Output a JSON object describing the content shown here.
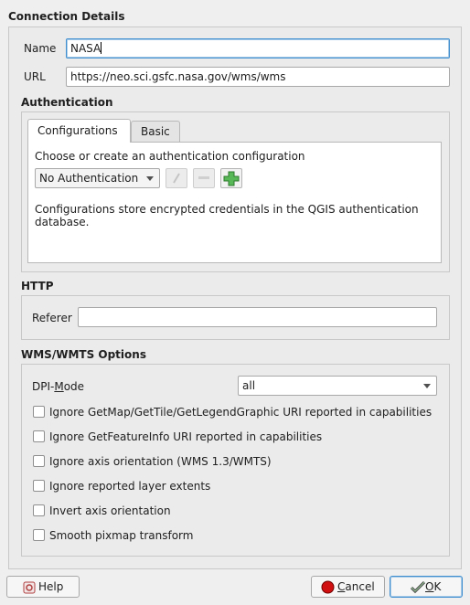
{
  "connection": {
    "title": "Connection Details",
    "name_label": "Name",
    "name_value": "NASA",
    "url_label": "URL",
    "url_value": "https://neo.sci.gsfc.nasa.gov/wms/wms"
  },
  "auth": {
    "title": "Authentication",
    "tabs": [
      "Configurations",
      "Basic"
    ],
    "choose_text": "Choose or create an authentication configuration",
    "selected": "No Authentication",
    "info_text": "Configurations store encrypted credentials in the QGIS authentication database."
  },
  "http": {
    "title": "HTTP",
    "referer_label": "Referer",
    "referer_value": ""
  },
  "wms": {
    "title": "WMS/WMTS Options",
    "dpi_label_pre": "DPI-",
    "dpi_label_u": "M",
    "dpi_label_post": "ode",
    "dpi_value": "all",
    "options": [
      "Ignore GetMap/GetTile/GetLegendGraphic URI reported in capabilities",
      "Ignore GetFeatureInfo URI reported in capabilities",
      "Ignore axis orientation (WMS 1.3/WMTS)",
      "Ignore reported layer extents",
      "Invert axis orientation",
      "Smooth pixmap transform"
    ]
  },
  "buttons": {
    "help": "Help",
    "cancel_u": "C",
    "cancel_rest": "ancel",
    "ok_u": "O",
    "ok_rest": "K"
  },
  "colors": {
    "focus": "#3e8ed0",
    "add_icon": "#2e9a2e",
    "cancel_icon": "#d01010"
  }
}
